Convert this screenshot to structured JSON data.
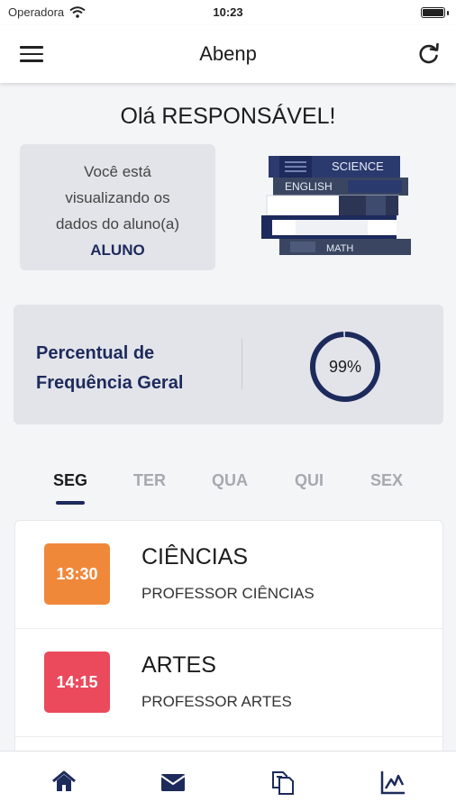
{
  "status_bar": {
    "carrier": "Operadora",
    "time": "10:23"
  },
  "app_bar": {
    "title": "Abenp"
  },
  "greeting": "Olá RESPONSÁVEL!",
  "student_card": {
    "line1": "Você está",
    "line2": "visualizando os",
    "line3": "dados do aluno(a)",
    "student_name": "ALUNO"
  },
  "books_illustration": {
    "labels": [
      "SCIENCE",
      "ENGLISH",
      "MATH"
    ]
  },
  "frequency": {
    "label_line1": "Percentual de",
    "label_line2": "Frequência Geral",
    "value_text": "99%",
    "value": 0.99
  },
  "day_tabs": [
    "SEG",
    "TER",
    "QUA",
    "QUI",
    "SEX"
  ],
  "active_day": "SEG",
  "schedule": [
    {
      "time": "13:30",
      "subject": "CIÊNCIAS",
      "teacher": "PROFESSOR CIÊNCIAS",
      "color": "#f0883a"
    },
    {
      "time": "14:15",
      "subject": "ARTES",
      "teacher": "PROFESSOR ARTES",
      "color": "#ea4a5c"
    }
  ],
  "bottom_nav": [
    "home-icon",
    "mail-icon",
    "documents-icon",
    "chart-icon"
  ],
  "colors": {
    "navy": "#1d2a5c",
    "card_bg": "#e3e4ea",
    "inactive_tab": "#a7a9b0"
  }
}
